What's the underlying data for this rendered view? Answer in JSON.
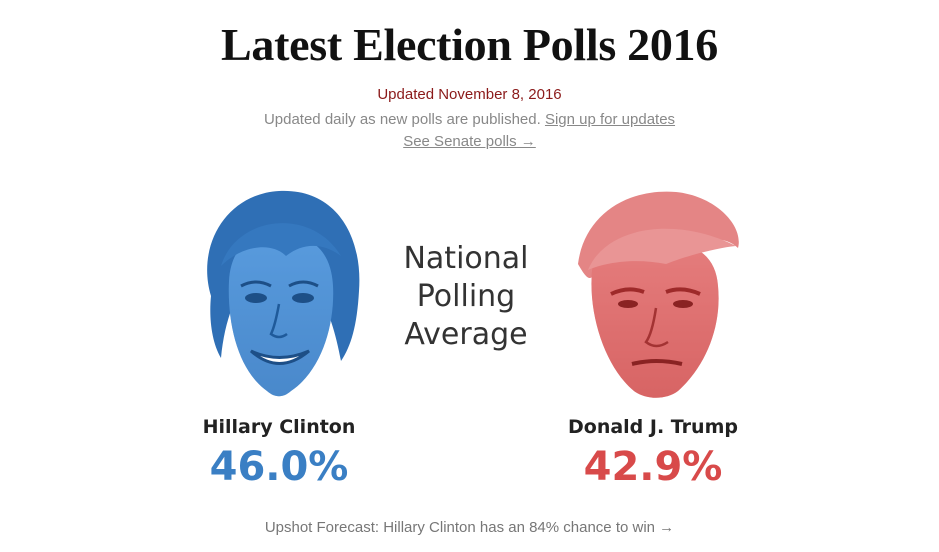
{
  "header": {
    "title": "Latest Election Polls 2016",
    "updated": "Updated November 8, 2016",
    "subtitle_text": "Updated daily as new polls are published.",
    "signup_link": "Sign up for updates",
    "senate_link": "See Senate polls →"
  },
  "center": {
    "line1": "National",
    "line2": "Polling",
    "line3": "Average"
  },
  "candidates": [
    {
      "name": "Hillary Clinton",
      "percent": "46.0%",
      "color": "#3a7fc4"
    },
    {
      "name": "Donald J. Trump",
      "percent": "42.9%",
      "color": "#d84a4a"
    }
  ],
  "footer": {
    "forecast_link": "Upshot Forecast: Hillary Clinton has an 84% chance to win →"
  },
  "colors": {
    "title": "#111111",
    "updated": "#8b1a1a",
    "muted": "#888888",
    "clinton": "#3a7fc4",
    "trump": "#d84a4a"
  }
}
